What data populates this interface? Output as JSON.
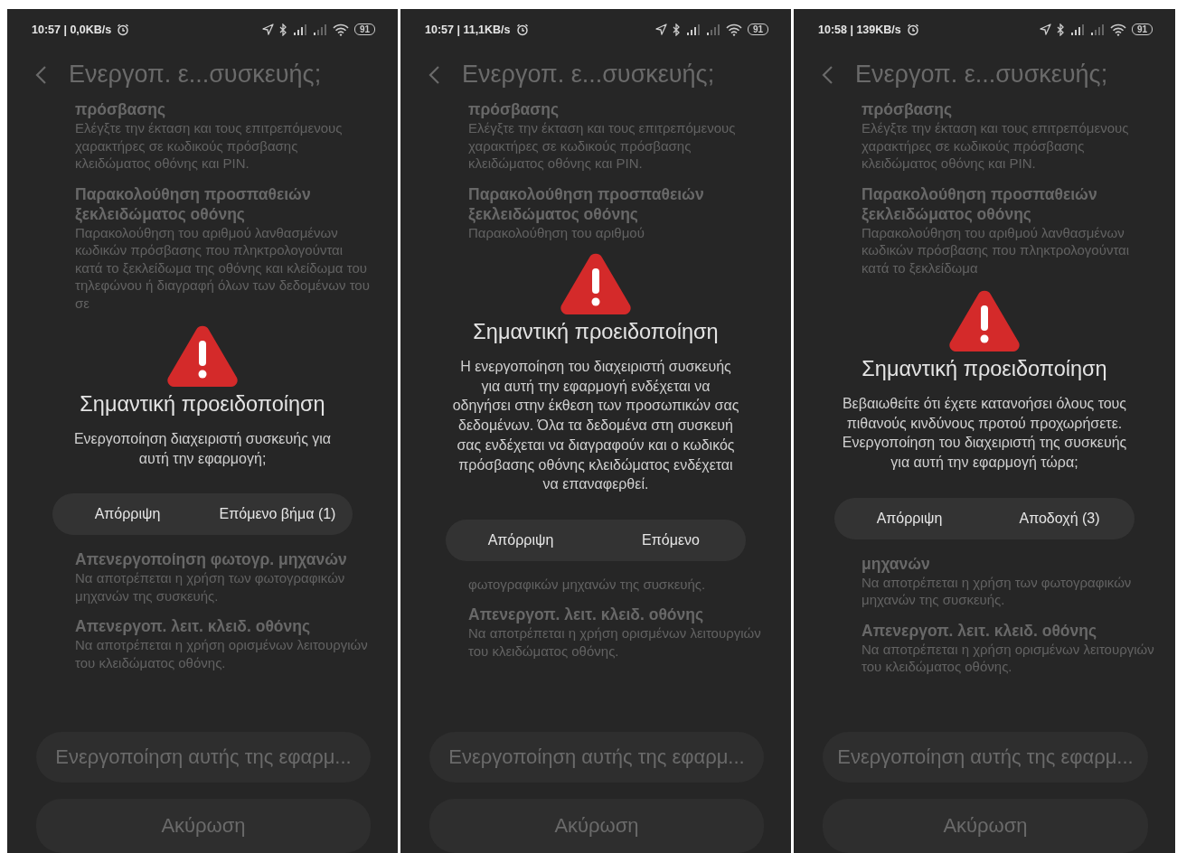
{
  "phones": [
    {
      "status_bar": {
        "time": "10:57 | 0,0KB/s",
        "battery": "91"
      },
      "title": "Ενεργοπ. ε...συσκευής;",
      "settings_above": [
        {
          "heading": "πρόσβασης",
          "description": "Ελέγξτε την έκταση και τους επιτρεπόμενους χαρακτήρες σε κωδικούς πρόσβασης κλειδώματος οθόνης και PIN."
        },
        {
          "heading": "Παρακολούθηση προσπαθειών ξεκλειδώματος οθόνης",
          "description": "Παρακολούθηση του αριθμού λανθασμένων κωδικών πρόσβασης που πληκτρολογούνται κατά το ξεκλείδωμα της οθόνης και κλείδωμα του τηλεφώνου ή διαγραφή όλων των δεδομένων του σε"
        }
      ],
      "dialog": {
        "title": "Σημαντική προειδοποίηση",
        "message": "Ενεργοποίηση διαχειριστή συσκευής για αυτή την εφαρμογή;",
        "buttons": [
          "Απόρριψη",
          "Επόμενο βήμα (1)"
        ]
      },
      "settings_below": [
        {
          "heading": "Απενεργοποίηση φωτογρ. μηχανών",
          "description": "Να αποτρέπεται η χρήση των φωτογραφικών μηχανών της συσκευής."
        },
        {
          "heading": "Απενεργοπ. λειτ. κλειδ. οθόνης",
          "description": "Να αποτρέπεται η χρήση ορισμένων λειτουργιών του κλειδώματος οθόνης."
        }
      ],
      "actions": [
        "Ενεργοποίηση αυτής της εφαρμ...",
        "Ακύρωση"
      ]
    },
    {
      "status_bar": {
        "time": "10:57 | 11,1KB/s",
        "battery": "91"
      },
      "title": "Ενεργοπ. ε...συσκευής;",
      "settings_above": [
        {
          "heading": "πρόσβασης",
          "description": "Ελέγξτε την έκταση και τους επιτρεπόμενους χαρακτήρες σε κωδικούς πρόσβασης κλειδώματος οθόνης και PIN."
        },
        {
          "heading": "Παρακολούθηση προσπαθειών ξεκλειδώματος οθόνης",
          "description": "Παρακολούθηση του αριθμού"
        }
      ],
      "dialog": {
        "title": "Σημαντική προειδοποίηση",
        "message": "Η ενεργοποίηση του διαχειριστή συσκευής για αυτή την εφαρμογή ενδέχεται να οδηγήσει στην έκθεση των προσωπικών σας δεδομένων. Όλα τα δεδομένα στη συσκευή σας ενδέχεται να διαγραφούν και ο κωδικός πρόσβασης οθόνης κλειδώματος ενδέχεται να επαναφερθεί.",
        "buttons": [
          "Απόρριψη",
          "Επόμενο"
        ]
      },
      "settings_below": [
        {
          "description": "φωτογραφικών μηχανών της συσκευής."
        },
        {
          "heading": "Απενεργοπ. λειτ. κλειδ. οθόνης",
          "description": "Να αποτρέπεται η χρήση ορισμένων λειτουργιών του κλειδώματος οθόνης."
        }
      ],
      "actions": [
        "Ενεργοποίηση αυτής της εφαρμ...",
        "Ακύρωση"
      ]
    },
    {
      "status_bar": {
        "time": "10:58 | 139KB/s",
        "battery": "91"
      },
      "title": "Ενεργοπ. ε...συσκευής;",
      "settings_above": [
        {
          "heading": "πρόσβασης",
          "description": "Ελέγξτε την έκταση και τους επιτρεπόμενους χαρακτήρες σε κωδικούς πρόσβασης κλειδώματος οθόνης και PIN."
        },
        {
          "heading": "Παρακολούθηση προσπαθειών ξεκλειδώματος οθόνης",
          "description": "Παρακολούθηση του αριθμού λανθασμένων κωδικών πρόσβασης που πληκτρολογούνται κατά το ξεκλείδωμα"
        }
      ],
      "dialog": {
        "title": "Σημαντική προειδοποίηση",
        "message": "Βεβαιωθείτε ότι έχετε κατανοήσει όλους τους πιθανούς κινδύνους προτού προχωρήσετε. Ενεργοποίηση του διαχειριστή της συσκευής για αυτή την εφαρμογή τώρα;",
        "buttons": [
          "Απόρριψη",
          "Αποδοχή (3)"
        ]
      },
      "settings_below": [
        {
          "heading": "μηχανών",
          "description": "Να αποτρέπεται η χρήση των φωτογραφικών μηχανών της συσκευής."
        },
        {
          "heading": "Απενεργοπ. λειτ. κλειδ. οθόνης",
          "description": "Να αποτρέπεται η χρήση ορισμένων λειτουργιών του κλειδώματος οθόνης."
        }
      ],
      "actions": [
        "Ενεργοποίηση αυτής της εφαρμ...",
        "Ακύρωση"
      ]
    }
  ]
}
